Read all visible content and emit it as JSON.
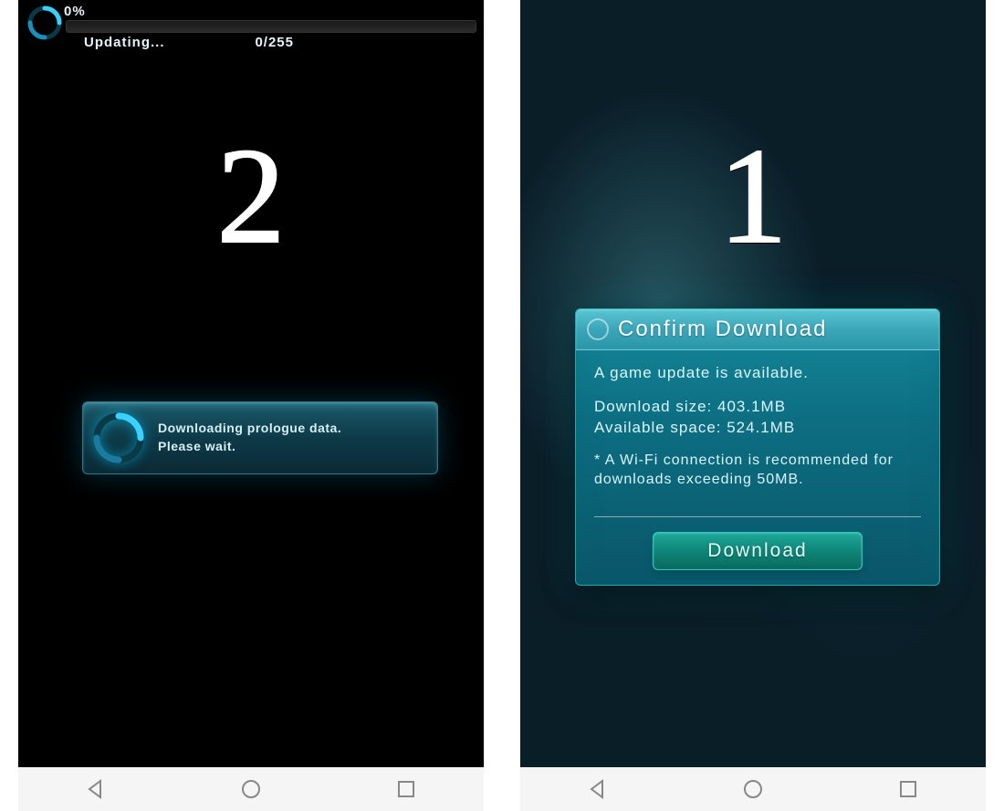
{
  "left": {
    "overlay_number": "2",
    "progress": {
      "percent_label": "0%",
      "status_text": "Updating...",
      "count_text": "0/255"
    },
    "banner": {
      "line1": "Downloading prologue data.",
      "line2": "Please wait."
    }
  },
  "right": {
    "overlay_number": "1",
    "dialog": {
      "title": "Confirm Download",
      "message": "A game update is available.",
      "download_size_label": "Download size: 403.1MB",
      "available_space_label": "Available space: 524.1MB",
      "note": "* A Wi-Fi connection is recommended for downloads exceeding 50MB.",
      "button_label": "Download"
    }
  }
}
